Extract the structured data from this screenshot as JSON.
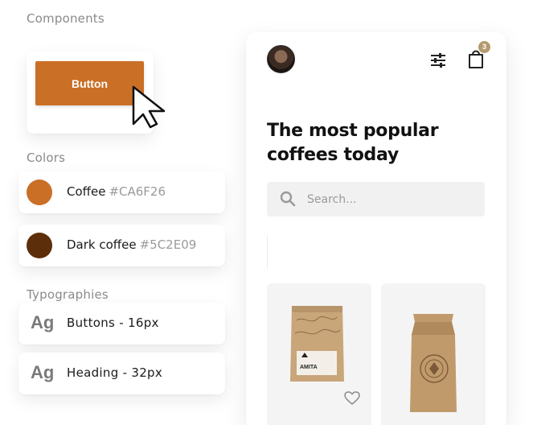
{
  "sections": {
    "components": "Components",
    "colors": "Colors",
    "typographies": "Typographies"
  },
  "components": {
    "button_label": "Button"
  },
  "colors": [
    {
      "name": "Coffee",
      "hex": "#CA6F26"
    },
    {
      "name": "Dark coffee",
      "hex": "#5C2E09"
    }
  ],
  "typography": [
    {
      "sample": "Ag",
      "label": "Buttons - 16px"
    },
    {
      "sample": "Ag",
      "label": "Heading - 32px"
    }
  ],
  "app": {
    "cart_count": "3",
    "title_line1": "The most popular",
    "title_line2": "coffees today",
    "search_placeholder": "Search...",
    "product_1_brand": "AMITA",
    "icons": {
      "avatar": "avatar",
      "filter": "sliders-icon",
      "bag": "shopping-bag-icon",
      "search": "search-icon",
      "favorite": "heart-icon"
    }
  },
  "palette": {
    "coffee": "#CA6F26",
    "dark_coffee": "#5C2E09",
    "badge": "#b59a6f"
  }
}
